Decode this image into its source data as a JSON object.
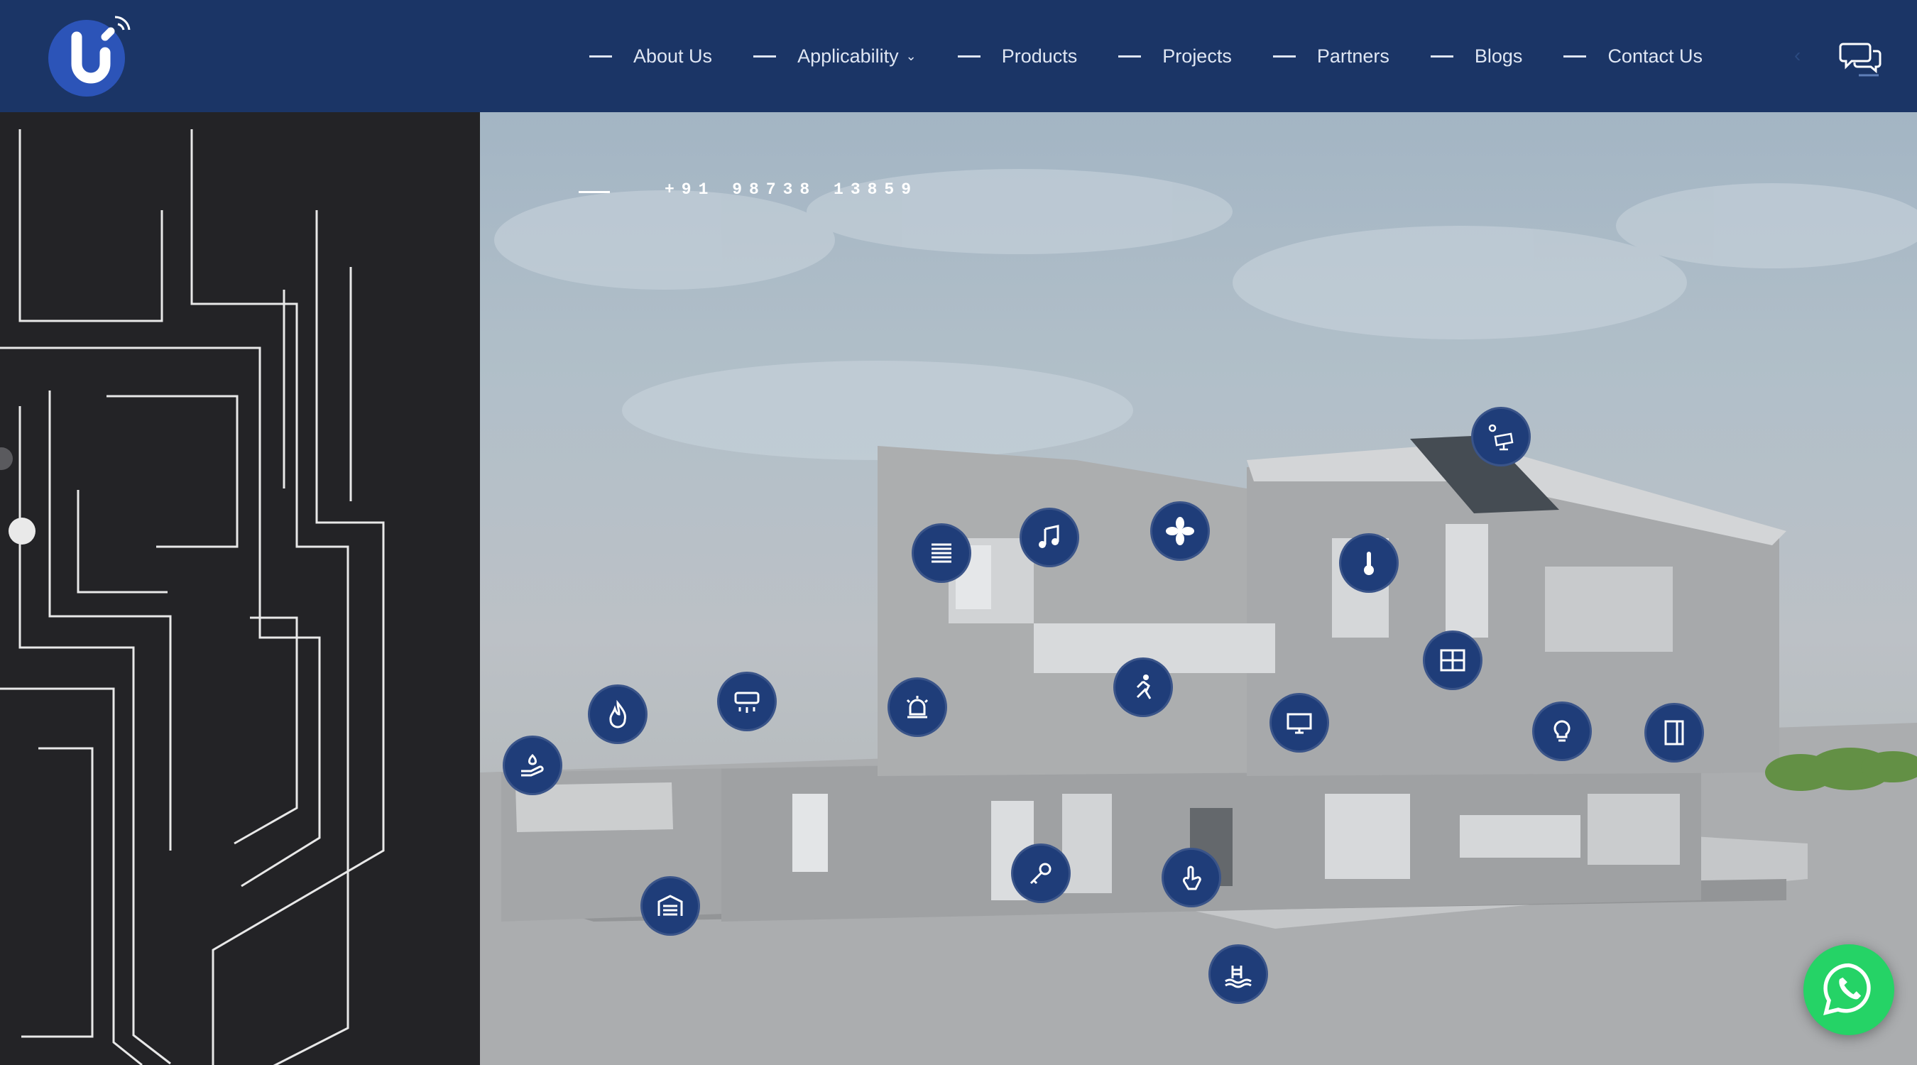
{
  "brand": {
    "logo": "smart-home-logo"
  },
  "nav": {
    "items": [
      {
        "label": "About Us",
        "has_dropdown": false
      },
      {
        "label": "Applicability",
        "has_dropdown": true
      },
      {
        "label": "Products",
        "has_dropdown": false
      },
      {
        "label": "Projects",
        "has_dropdown": false
      },
      {
        "label": "Partners",
        "has_dropdown": false
      },
      {
        "label": "Blogs",
        "has_dropdown": false
      },
      {
        "label": "Contact Us",
        "has_dropdown": false
      }
    ]
  },
  "hero": {
    "phone": "+91 98738 13859",
    "feature_icons": [
      "window-blinds-icon",
      "music-icon",
      "fan-icon",
      "solar-panel-icon",
      "thermometer-icon",
      "window-icon",
      "motion-sensor-icon",
      "tv-icon",
      "light-bulb-icon",
      "door-icon",
      "fire-icon",
      "ac-unit-icon",
      "alarm-icon",
      "garden-irrigation-icon",
      "garage-icon",
      "key-icon",
      "touch-icon",
      "pool-icon"
    ],
    "slide_count": 6,
    "active_slide": 1
  },
  "colors": {
    "header": "#1b3566",
    "accent": "#1f3d79",
    "dark_panel": "#232326",
    "whatsapp": "#25d366"
  }
}
